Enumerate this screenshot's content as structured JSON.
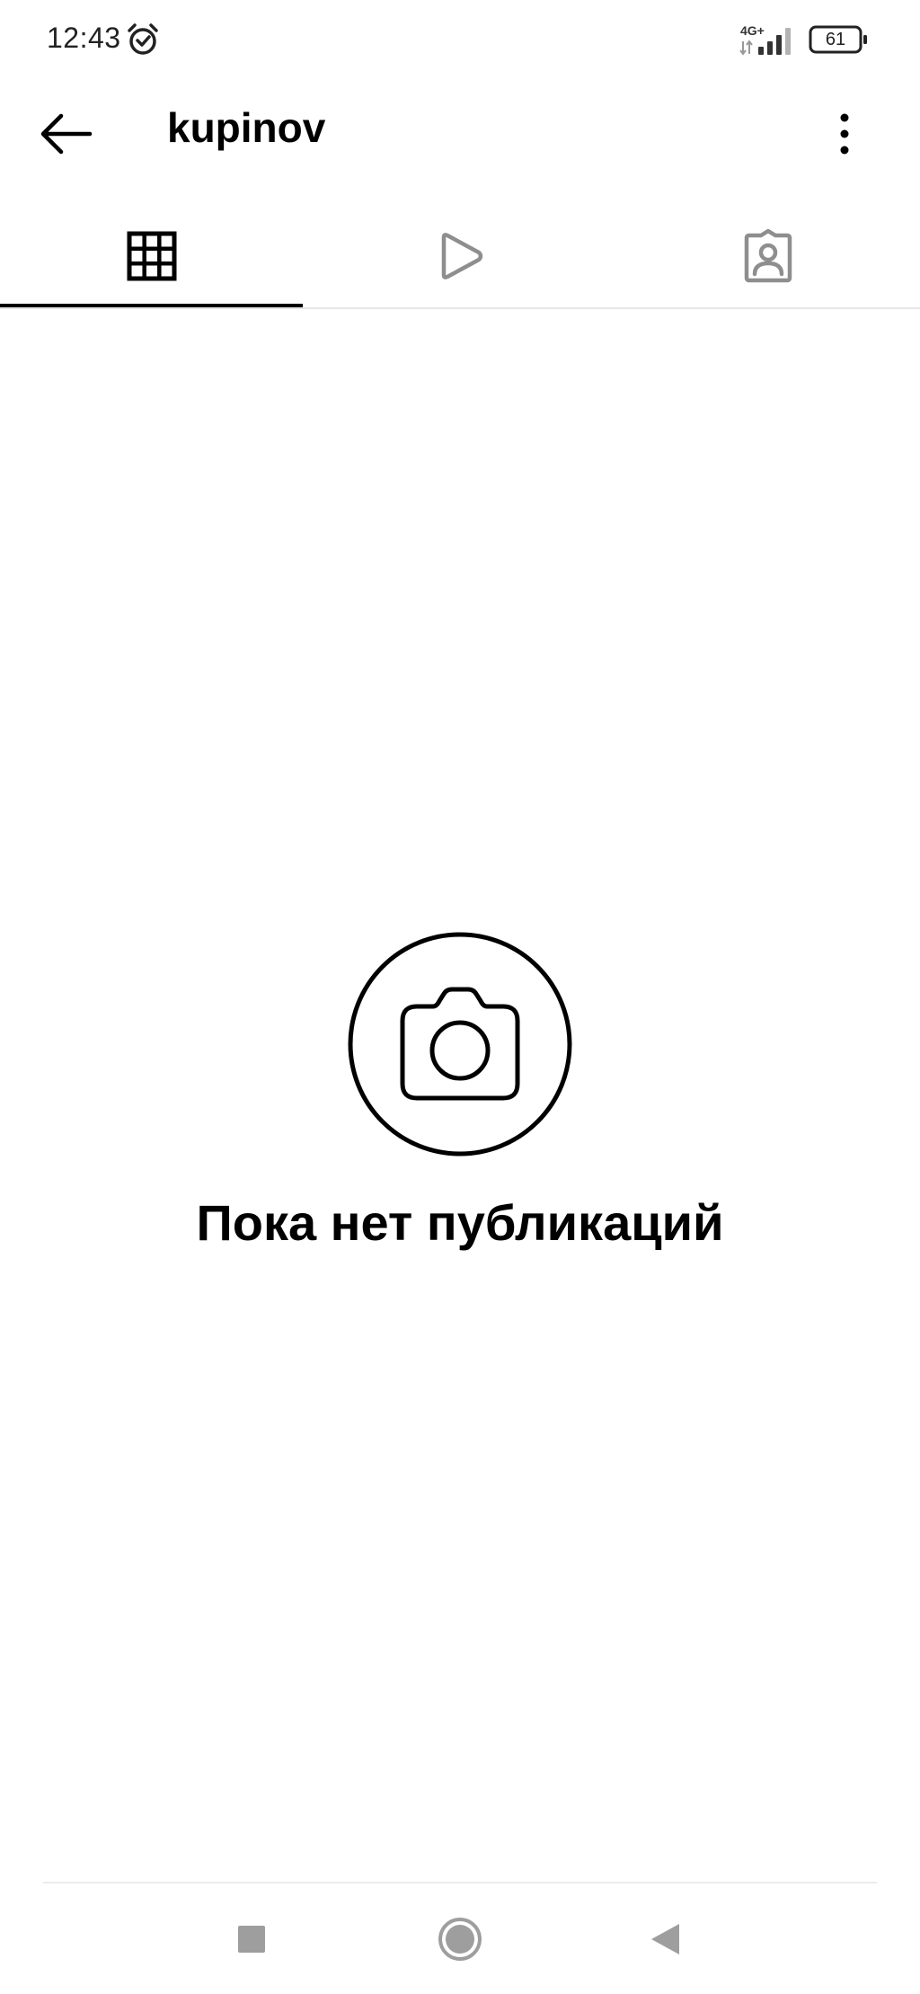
{
  "status_bar": {
    "time": "12:43",
    "network_type": "4G+",
    "battery_level": "61"
  },
  "header": {
    "username": "kupinov",
    "back_icon": "arrow-left-icon",
    "menu_icon": "more-vertical-icon"
  },
  "tabs": [
    {
      "name": "posts",
      "icon": "grid-icon",
      "selected": true
    },
    {
      "name": "reels",
      "icon": "play-icon",
      "selected": false
    },
    {
      "name": "tagged",
      "icon": "tagged-person-icon",
      "selected": false
    }
  ],
  "empty_state": {
    "icon": "camera-icon",
    "message": "Пока нет публикаций"
  },
  "navigation_bar": {
    "buttons": [
      "recents-square-icon",
      "home-circle-icon",
      "back-triangle-icon"
    ]
  },
  "colors": {
    "text_primary": "#000000",
    "icon_inactive": "#8e8e8e",
    "divider": "#e6e6e6",
    "nav_icon": "#9e9e9e"
  }
}
